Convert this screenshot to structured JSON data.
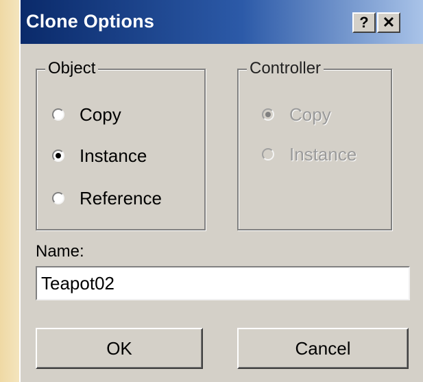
{
  "window": {
    "title": "Clone Options",
    "help_button": "?",
    "close_button": "✕"
  },
  "object_group": {
    "label": "Object",
    "options": [
      {
        "label": "Copy",
        "selected": false
      },
      {
        "label": "Instance",
        "selected": true
      },
      {
        "label": "Reference",
        "selected": false
      }
    ]
  },
  "controller_group": {
    "label": "Controller",
    "enabled": false,
    "options": [
      {
        "label": "Copy",
        "selected": true
      },
      {
        "label": "Instance",
        "selected": false
      }
    ]
  },
  "name_field": {
    "label": "Name:",
    "value": "Teapot02"
  },
  "buttons": {
    "ok": "OK",
    "cancel": "Cancel"
  },
  "colors": {
    "title_gradient_start": "#0a2a6a",
    "title_gradient_end": "#a9c3e8",
    "dialog_face": "#d4d0c8",
    "background": "#f3e2b8"
  }
}
